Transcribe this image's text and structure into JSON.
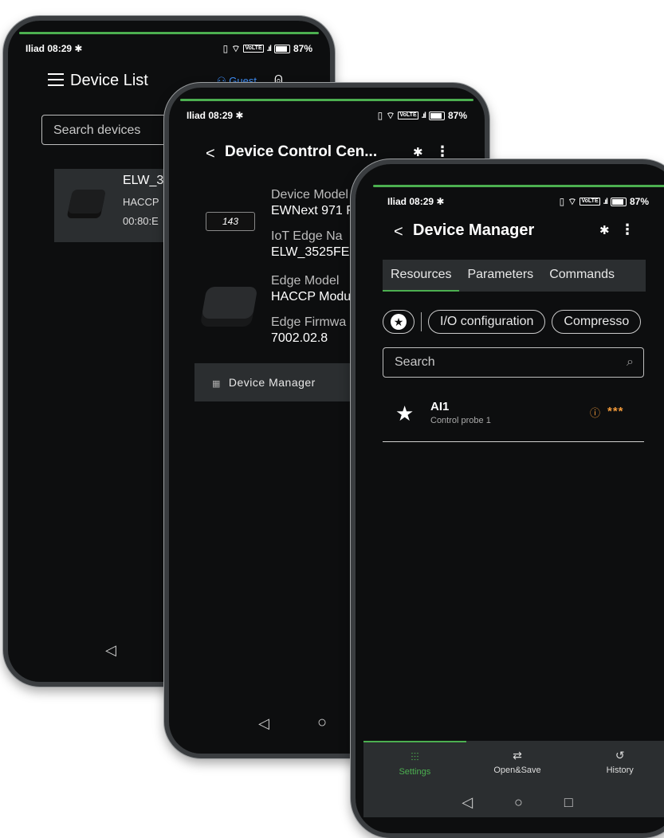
{
  "status": {
    "carrier": "Iliad",
    "time": "08:29",
    "battery": "87%",
    "volte": "VoLTE"
  },
  "accent_green": "#4caf50",
  "accent_blue": "#3e8ef7",
  "accent_orange": "#f29a3a",
  "phone1": {
    "title": "Device List",
    "guest": "Guest",
    "search_placeholder": "Search devices",
    "device": {
      "name": "ELW_3",
      "model": "HACCP",
      "mac": "00:80:E"
    },
    "nav": {
      "back": "◁",
      "home": "○"
    }
  },
  "phone2": {
    "title": "Device Control Cen...",
    "back": "<",
    "more": "⋮",
    "display_value": "143",
    "rows": [
      {
        "label": "Device Model",
        "value": "EWNext 971 F"
      },
      {
        "label": "IoT Edge Na",
        "value": "ELW_3525FE"
      },
      {
        "label": "Edge Model",
        "value": "HACCP Modu"
      },
      {
        "label": "Edge Firmwa",
        "value": "7002.02.8"
      }
    ],
    "button": "Device Manager",
    "nav": {
      "back": "◁",
      "home": "○"
    }
  },
  "phone3": {
    "title": "Device Manager",
    "back": "<",
    "more": "⋮",
    "tabs": [
      {
        "label": "Resources",
        "active": true
      },
      {
        "label": "Parameters",
        "active": false
      },
      {
        "label": "Commands",
        "active": false
      }
    ],
    "chips": [
      "I/O configuration",
      "Compresso"
    ],
    "search_placeholder": "Search",
    "item": {
      "name": "AI1",
      "desc": "Control probe 1",
      "level": "***"
    },
    "bottom_nav": [
      {
        "label": "Settings",
        "icon": "sliders-icon",
        "active": true
      },
      {
        "label": "Open&Save",
        "icon": "swap-icon",
        "active": false
      },
      {
        "label": "History",
        "icon": "history-icon",
        "active": false
      }
    ],
    "sysnav": {
      "back": "◁",
      "home": "○",
      "recent": "□"
    }
  }
}
